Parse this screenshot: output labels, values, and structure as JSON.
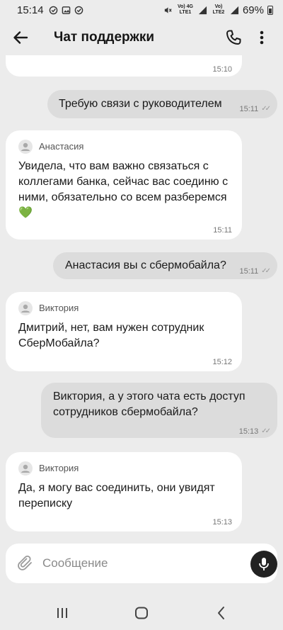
{
  "status_bar": {
    "time": "15:14",
    "network_1": "Vo) 4G LTE1",
    "network_2": "Vo) LTE2",
    "battery": "69%"
  },
  "header": {
    "title": "Чат поддержки",
    "icons": [
      "back-arrow-icon",
      "phone-icon",
      "more-vertical-icon"
    ]
  },
  "messages": [
    {
      "type": "incoming",
      "sender": "",
      "text": "",
      "time": "15:10"
    },
    {
      "type": "outgoing",
      "text": "Требую связи с руководителем",
      "time": "15:11"
    },
    {
      "type": "incoming",
      "sender": "Анастасия",
      "text": "Увидела, что вам важно связаться с коллегами банка, сейчас вас соединю с ними, обязательно со всем разберемся💚",
      "time": "15:11"
    },
    {
      "type": "outgoing",
      "text": "Анастасия вы с сбермобайла?",
      "time": "15:11"
    },
    {
      "type": "incoming",
      "sender": "Виктория",
      "text": "Дмитрий, нет, вам нужен сотрудник СберМобайла?",
      "time": "15:12"
    },
    {
      "type": "outgoing",
      "text": "Виктория, а у этого чата есть доступ сотрудников сбермобайла?",
      "time": "15:13"
    },
    {
      "type": "incoming",
      "sender": "Виктория",
      "text": "Да, я могу вас соединить, они увидят переписку",
      "time": "15:13"
    }
  ],
  "composer": {
    "placeholder": "Сообщение",
    "value": ""
  },
  "colors": {
    "background": "#ececec",
    "incoming_bubble": "#ffffff",
    "outgoing_bubble": "#dcdcdc",
    "heart": "#2ecc71"
  }
}
